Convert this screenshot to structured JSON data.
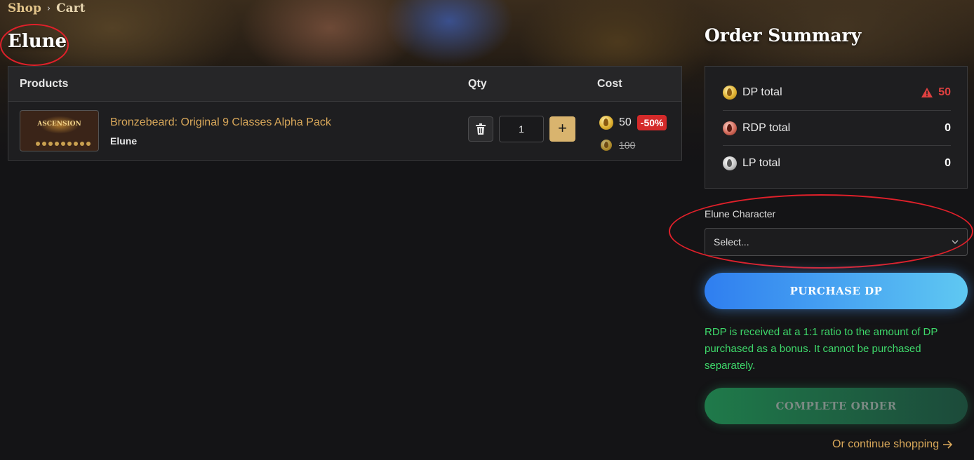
{
  "breadcrumb": {
    "shop": "Shop",
    "separator": "›",
    "current": "Cart"
  },
  "page": {
    "title": "Elune"
  },
  "cart": {
    "headers": {
      "products": "Products",
      "qty": "Qty",
      "cost": "Cost"
    },
    "items": [
      {
        "thumb_text": "ASCENSION",
        "name": "Bronzebeard: Original 9 Classes Alpha Pack",
        "realm": "Elune",
        "qty": "1",
        "plus_label": "+",
        "price": "50",
        "discount": "-50%",
        "original_price": "100"
      }
    ]
  },
  "summary": {
    "title": "Order Summary",
    "rows": [
      {
        "label": "DP total",
        "value": "50",
        "icon": "dp-coin-icon",
        "warning": true
      },
      {
        "label": "RDP total",
        "value": "0",
        "icon": "rdp-coin-icon"
      },
      {
        "label": "LP total",
        "value": "0",
        "icon": "lp-coin-icon"
      }
    ]
  },
  "character": {
    "label": "Elune Character",
    "placeholder": "Select..."
  },
  "buttons": {
    "purchase": "PURCHASE DP",
    "complete": "COMPLETE ORDER"
  },
  "note": "RDP is received at a 1:1 ratio to the amount of DP purchased as a bonus. It cannot be purchased separately.",
  "continue_link": "Or continue shopping",
  "colors": {
    "accent_gold": "#d9a85a",
    "warning_red": "#e04040",
    "note_green": "#3ed86a",
    "annotation_red": "#e0202a"
  }
}
